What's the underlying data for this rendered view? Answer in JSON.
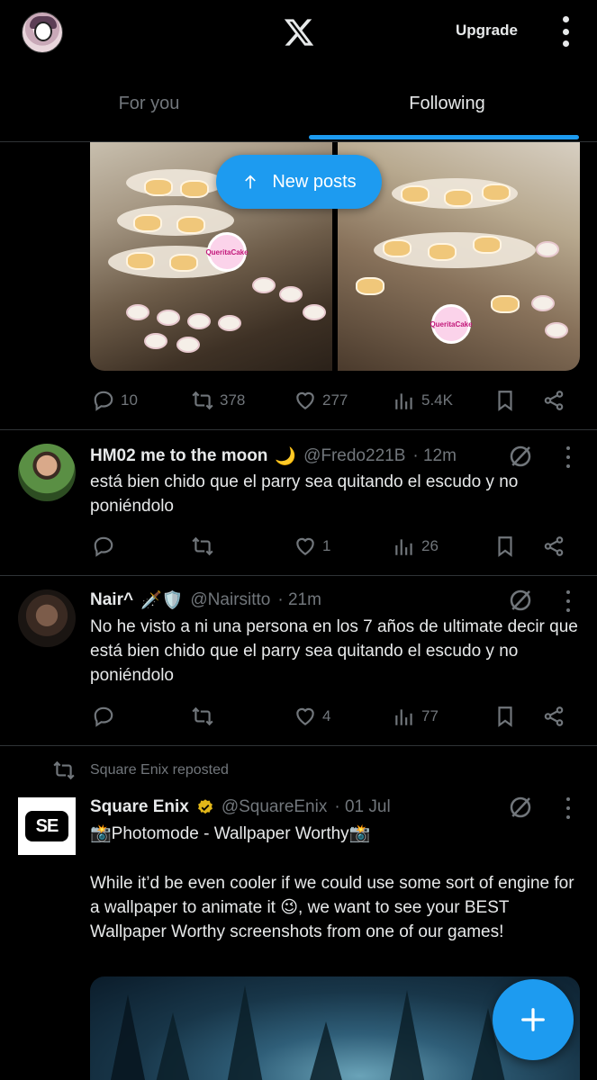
{
  "header": {
    "upgrade_label": "Upgrade",
    "logo": "x-logo"
  },
  "tabs": [
    {
      "label": "For you",
      "active": false
    },
    {
      "label": "Following",
      "active": true
    }
  ],
  "new_posts_label": "New posts",
  "post1": {
    "media_logo_text": "QueritaCake",
    "stats": {
      "replies": "10",
      "reposts": "378",
      "likes": "277",
      "views": "5.4K"
    }
  },
  "post2": {
    "name": "HM02 me to the moon",
    "name_emoji": "🌙",
    "handle": "@Fredo221B",
    "time": "· 12m",
    "text": "está bien chido que el parry sea quitando el escudo y no poniéndolo",
    "stats": {
      "replies": "",
      "reposts": "",
      "likes": "1",
      "views": "26"
    }
  },
  "post3": {
    "name": "Nair^",
    "name_emoji": "🗡️🛡️",
    "handle": "@Nairsitto",
    "time": "· 21m",
    "text": "No he visto a ni una persona en los 7 años de ultimate decir que está bien chido que el parry sea quitando el escudo y no poniéndolo",
    "stats": {
      "replies": "",
      "reposts": "",
      "likes": "4",
      "views": "77"
    }
  },
  "post4": {
    "repost_label": "Square Enix reposted",
    "avatar_text": "SE",
    "name": "Square Enix",
    "handle": "@SquareEnix",
    "time": "· 01 Jul",
    "text_line1": "📸Photomode - Wallpaper Worthy📸",
    "text_body": "While it’d be even cooler if we could use some sort of engine for a wallpaper to animate it 😉, we want to see your BEST Wallpaper Worthy screenshots from one of our games!"
  },
  "colors": {
    "accent": "#1d9bf0",
    "background": "#000000",
    "muted": "#71767b",
    "verified": "#e2b719"
  }
}
